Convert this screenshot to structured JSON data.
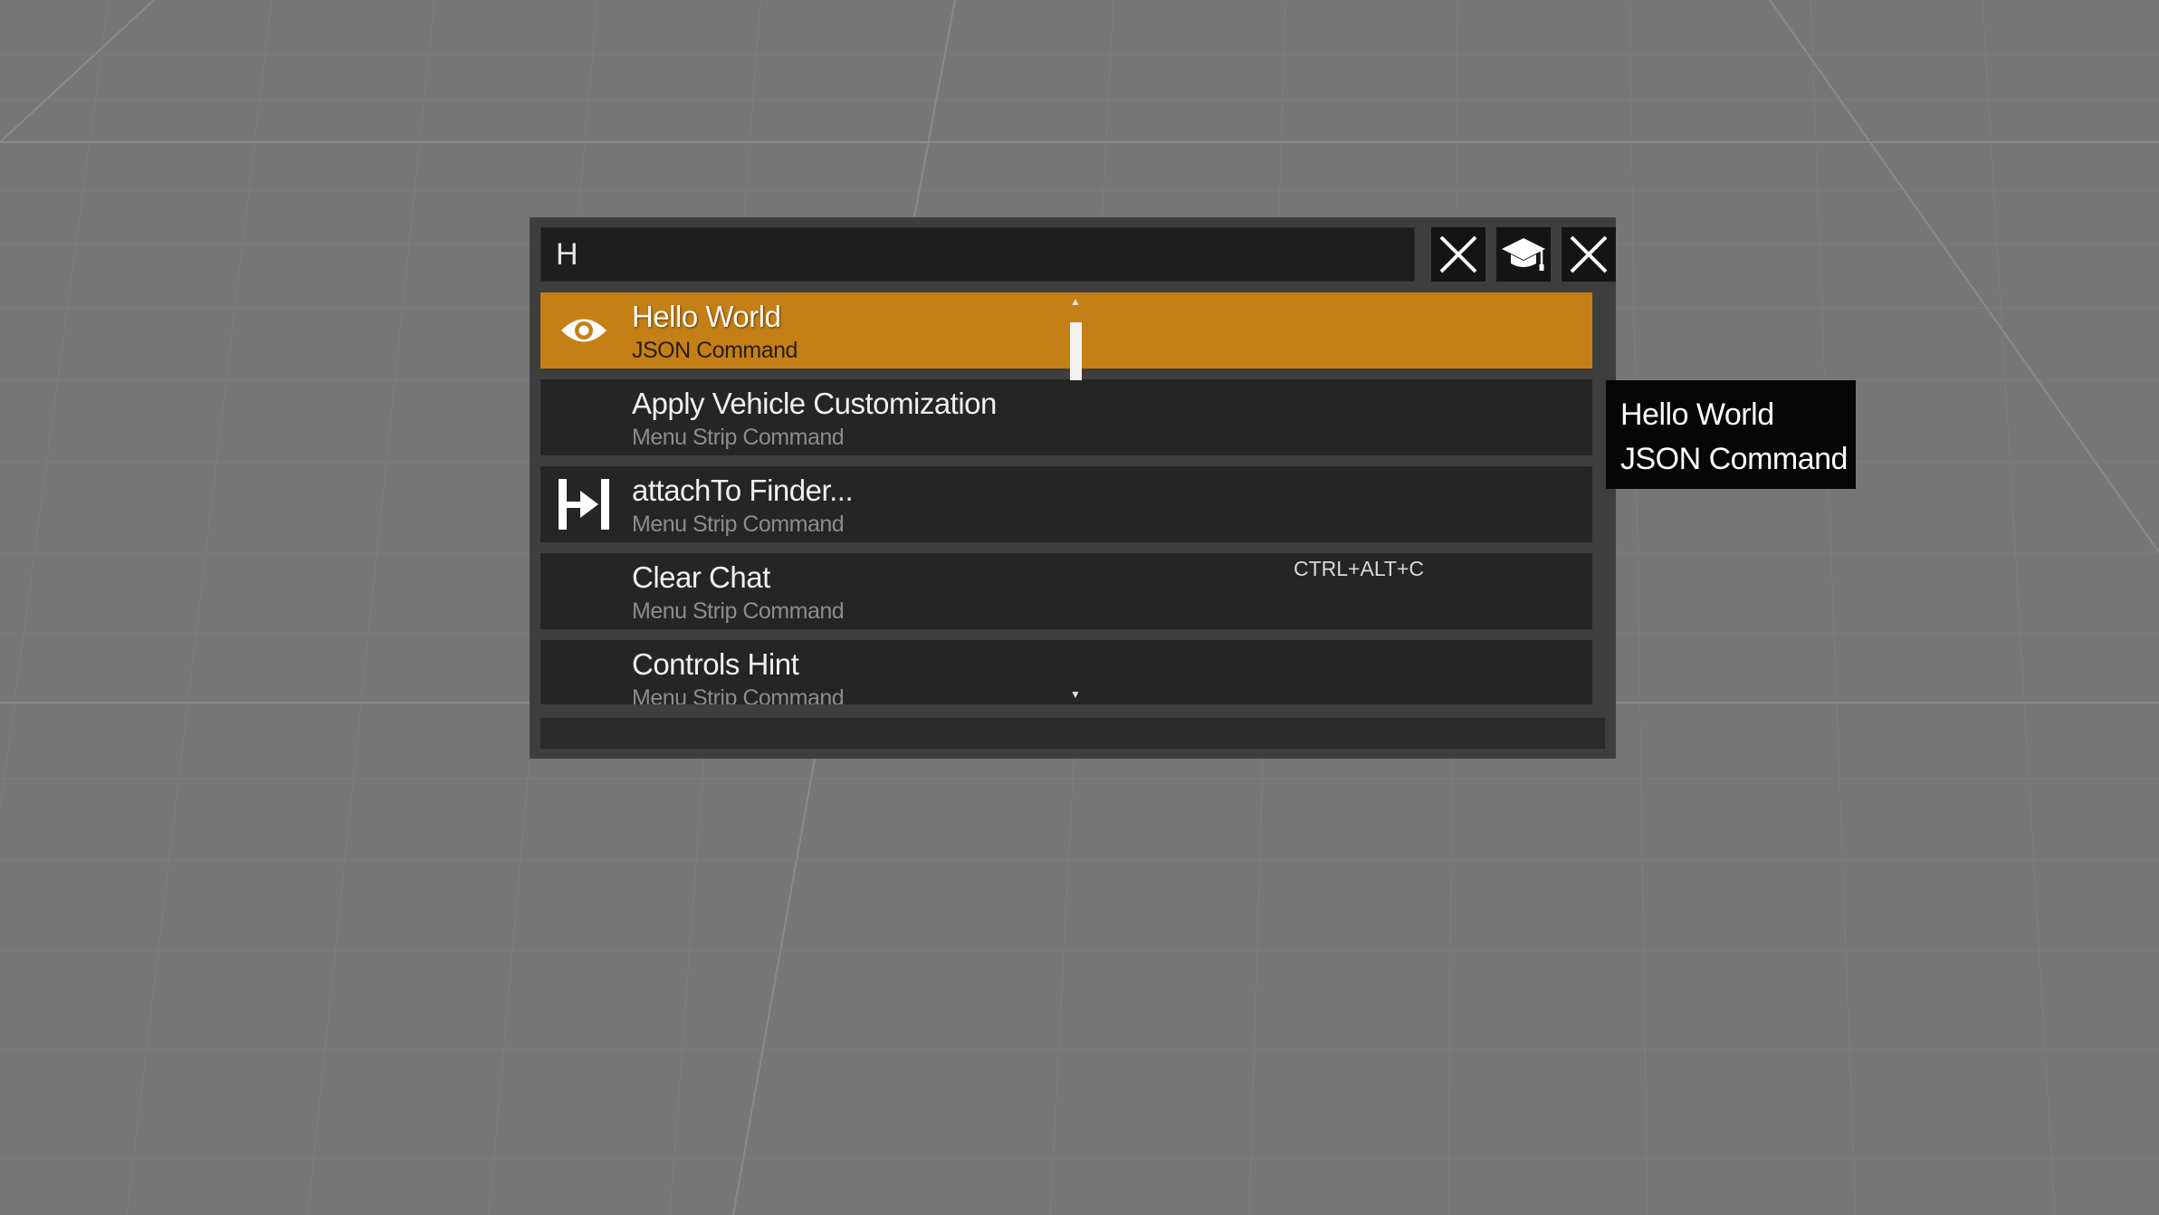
{
  "search": {
    "value": "H",
    "placeholder": ""
  },
  "toolbar": {
    "clear_icon": "close-x-icon",
    "tutorial_icon": "graduation-cap-icon",
    "close_icon": "close-x-icon"
  },
  "results": [
    {
      "title": "Hello World",
      "subtitle": "JSON Command",
      "shortcut": "",
      "icon": "eye-icon",
      "selected": true
    },
    {
      "title": "Apply Vehicle Customization",
      "subtitle": "Menu Strip Command",
      "shortcut": "",
      "icon": "",
      "selected": false
    },
    {
      "title": "attachTo Finder...",
      "subtitle": "Menu Strip Command",
      "shortcut": "",
      "icon": "attach-arrow-icon",
      "selected": false
    },
    {
      "title": "Clear Chat",
      "subtitle": "Menu Strip Command",
      "shortcut": "CTRL+ALT+C",
      "icon": "",
      "selected": false
    },
    {
      "title": "Controls Hint",
      "subtitle": "Menu Strip Command",
      "shortcut": "",
      "icon": "",
      "selected": false
    }
  ],
  "tooltip": {
    "line1": "Hello World",
    "line2": "JSON Command"
  },
  "colors": {
    "background": "#767676",
    "panel": "#3e3e3e",
    "row": "#252525",
    "selected_row": "#c48016",
    "tooltip_bg": "#060606"
  }
}
